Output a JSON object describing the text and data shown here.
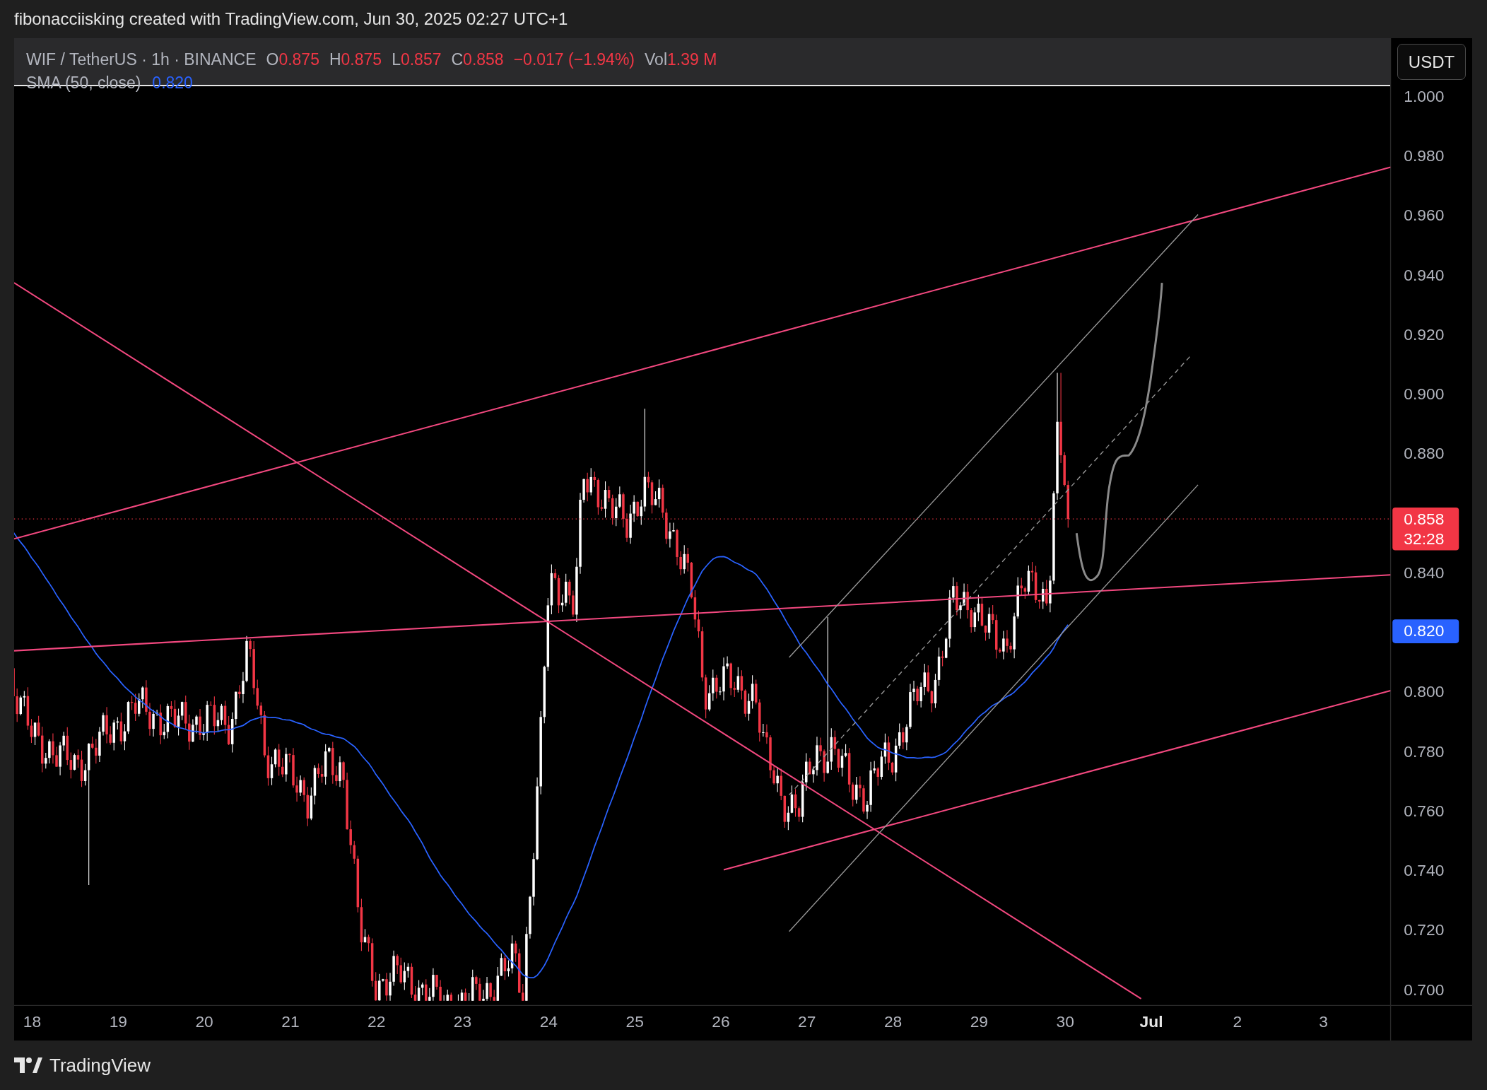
{
  "attribution": "fibonacciisking created with TradingView.com, Jun 30, 2025 02:27 UTC+1",
  "legend": {
    "symbol": "WIF / TetherUS · 1h · BINANCE",
    "ohlc": [
      {
        "label": "O",
        "value": "0.875"
      },
      {
        "label": "H",
        "value": "0.875"
      },
      {
        "label": "L",
        "value": "0.857"
      },
      {
        "label": "C",
        "value": "0.858"
      }
    ],
    "change": "−0.017 (−1.94%)",
    "volume": {
      "label": "Vol",
      "value": "1.39 M"
    },
    "indicator": {
      "name": "SMA (50, close)",
      "value": "0.820"
    }
  },
  "currency_button": "USDT",
  "price_axis": {
    "ticks": [
      "1.000",
      "0.980",
      "0.960",
      "0.940",
      "0.920",
      "0.900",
      "0.880",
      "0.840",
      "0.800",
      "0.780",
      "0.760",
      "0.740",
      "0.720",
      "0.700"
    ],
    "last_price": {
      "value": "0.858",
      "countdown": "32:28"
    },
    "sma_price": "0.820"
  },
  "time_axis": {
    "labels": [
      {
        "text": "18",
        "kind": "day"
      },
      {
        "text": "19",
        "kind": "day"
      },
      {
        "text": "20",
        "kind": "day"
      },
      {
        "text": "21",
        "kind": "day"
      },
      {
        "text": "22",
        "kind": "day"
      },
      {
        "text": "23",
        "kind": "day"
      },
      {
        "text": "24",
        "kind": "day"
      },
      {
        "text": "25",
        "kind": "day"
      },
      {
        "text": "26",
        "kind": "day"
      },
      {
        "text": "27",
        "kind": "day"
      },
      {
        "text": "28",
        "kind": "day"
      },
      {
        "text": "29",
        "kind": "day"
      },
      {
        "text": "30",
        "kind": "day"
      },
      {
        "text": "Jul",
        "kind": "month"
      },
      {
        "text": "2",
        "kind": "day"
      },
      {
        "text": "3",
        "kind": "day"
      }
    ]
  },
  "footer": {
    "brand": "TradingView"
  }
}
